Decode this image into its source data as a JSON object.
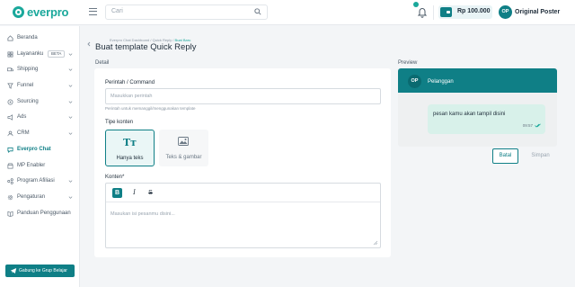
{
  "brand": {
    "name": "everpro",
    "color": "#1aa89b"
  },
  "header": {
    "search_placeholder": "Cari",
    "balance": "Rp 100.000",
    "user_initials": "OP",
    "user_name": "Original Poster"
  },
  "sidebar": {
    "items": [
      {
        "label": "Beranda",
        "icon": "home-icon"
      },
      {
        "label": "Layananku",
        "icon": "grid-icon",
        "badge": "BETA",
        "expandable": true
      },
      {
        "label": "Shipping",
        "icon": "truck-icon",
        "expandable": true
      },
      {
        "label": "Funnel",
        "icon": "funnel-icon",
        "expandable": true
      },
      {
        "label": "Sourcing",
        "icon": "sourcing-icon",
        "expandable": true
      },
      {
        "label": "Ads",
        "icon": "megaphone-icon",
        "expandable": true
      },
      {
        "label": "CRM",
        "icon": "crm-icon",
        "expandable": true
      },
      {
        "label": "Everpro Chat",
        "icon": "chat-icon",
        "active": true
      },
      {
        "label": "MP Enabler",
        "icon": "store-icon"
      },
      {
        "label": "Program Afiliasi",
        "icon": "affiliate-icon",
        "expandable": true
      },
      {
        "label": "Pengaturan",
        "icon": "gear-icon",
        "expandable": true
      },
      {
        "label": "Panduan Penggunaan",
        "icon": "book-icon"
      }
    ],
    "join_button": "Gabung ke Grup Belajar"
  },
  "breadcrumb": {
    "items": [
      "Everpro Chat Dashboard",
      "Quick Reply"
    ],
    "current": "Buat Baru"
  },
  "page": {
    "title": "Buat template Quick Reply",
    "detail_label": "Detail",
    "preview_label": "Preview"
  },
  "form": {
    "command_label": "Perintah / Command",
    "command_placeholder": "Masukkan perintah",
    "command_help": "Perintah untuk memanggil/menggunakan template",
    "content_type_label": "Tipe konten",
    "content_types": [
      {
        "label": "Hanya teks",
        "icon": "text-icon",
        "selected": true
      },
      {
        "label": "Teks & gambar",
        "icon": "image-icon",
        "selected": false
      }
    ],
    "content_label": "Konten*",
    "content_placeholder": "Masukan isi pesanmu disini...",
    "toolbar": {
      "bold": "B",
      "italic": "I",
      "strike": "S"
    }
  },
  "preview": {
    "avatar": "OP",
    "contact_name": "Pelanggan",
    "message": "pesan kamu akan tampil disini",
    "time": "09:57"
  },
  "actions": {
    "cancel": "Batal",
    "save": "Simpan"
  },
  "colors": {
    "primary": "#0f7f86",
    "accent": "#1aa89b",
    "bubble": "#d8f1ea"
  }
}
